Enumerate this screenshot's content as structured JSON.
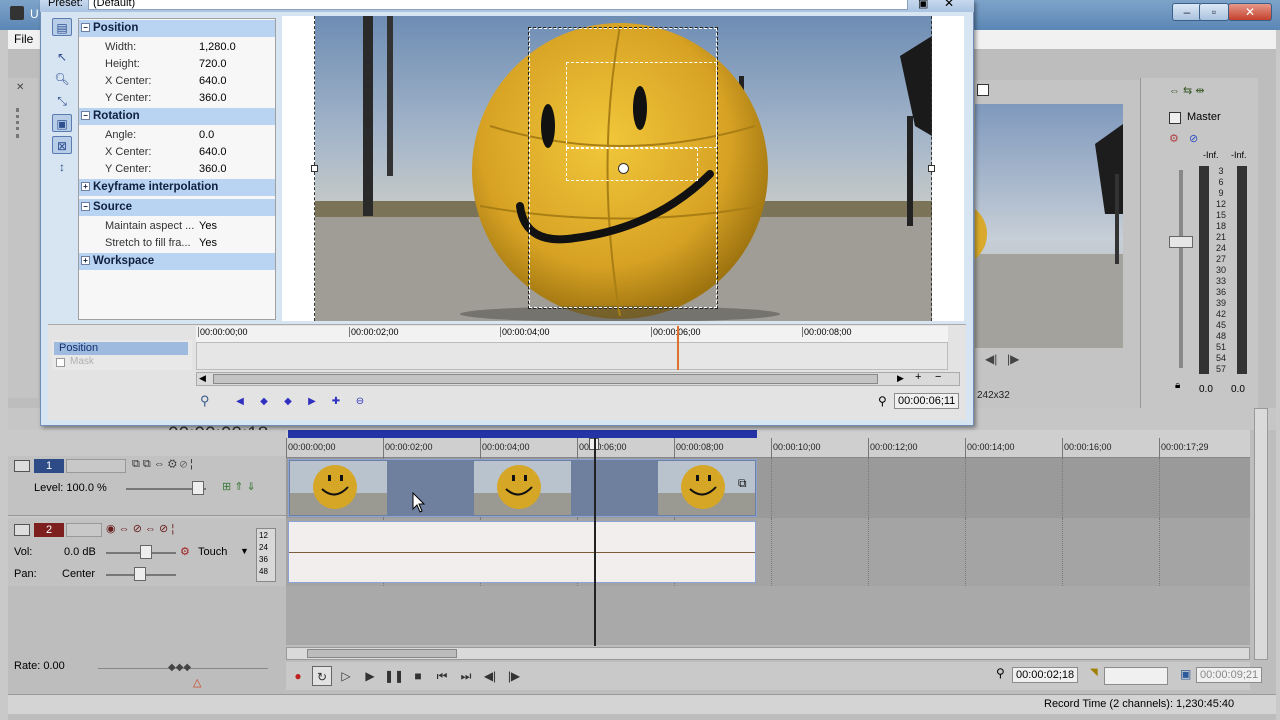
{
  "app": {
    "title": "U",
    "menu": [
      "File"
    ],
    "window_controls": [
      "–",
      "▫",
      "✕"
    ]
  },
  "dialog": {
    "preset_label": "Preset:",
    "preset_value": "(Default)",
    "properties": {
      "sections": [
        {
          "label": "Position",
          "expanded": true,
          "rows": [
            {
              "key": "Width:",
              "value": "1,280.0"
            },
            {
              "key": "Height:",
              "value": "720.0"
            },
            {
              "key": "X Center:",
              "value": "640.0"
            },
            {
              "key": "Y Center:",
              "value": "360.0"
            }
          ]
        },
        {
          "label": "Rotation",
          "expanded": true,
          "rows": [
            {
              "key": "Angle:",
              "value": "0.0"
            },
            {
              "key": "X Center:",
              "value": "640.0"
            },
            {
              "key": "Y Center:",
              "value": "360.0"
            }
          ]
        },
        {
          "label": "Keyframe interpolation",
          "expanded": false,
          "rows": []
        },
        {
          "label": "Source",
          "expanded": true,
          "rows": [
            {
              "key": "Maintain aspect ...",
              "value": "Yes"
            },
            {
              "key": "Stretch to fill fra...",
              "value": "Yes"
            }
          ]
        },
        {
          "label": "Workspace",
          "expanded": false,
          "rows": []
        }
      ]
    },
    "keyframes": {
      "tracks": [
        "Position",
        "Mask"
      ],
      "ruler": [
        "00:00:00;00",
        "00:00:02;00",
        "00:00:04;00",
        "00:00:06;00",
        "00:00:08;00"
      ],
      "cursor_time": "00:00:06;11"
    }
  },
  "timeline": {
    "current_time": "00:00:02;18",
    "ruler": [
      "00:00:00;00",
      "00:00:02;00",
      "00:00:04;00",
      "00:00:06;00",
      "00:00:08;00",
      "00:00:10;00",
      "00:00:12;00",
      "00:00:14;00",
      "00:00:16;00",
      "00:00:17;29"
    ],
    "video_track": {
      "number": "1",
      "level_label": "Level: 100.0 %"
    },
    "audio_track": {
      "number": "2",
      "vol_label": "Vol:",
      "vol_value": "0.0 dB",
      "pan_label": "Pan:",
      "pan_value": "Center",
      "touch_label": "Touch",
      "meter_scale": [
        "12",
        "24",
        "36",
        "48"
      ]
    },
    "rate_label": "Rate: 0.00",
    "cursor_time_box": "00:00:02;18",
    "end_time_box": "00:00:09;21",
    "status": "Record Time (2 channels): 1,230:45:40"
  },
  "preview": {
    "resolution_text": "242x32"
  },
  "mixer": {
    "title": "Master",
    "inf_left": "-Inf.",
    "inf_right": "-Inf.",
    "scale": [
      "3",
      "6",
      "9",
      "12",
      "15",
      "18",
      "21",
      "24",
      "27",
      "30",
      "33",
      "36",
      "39",
      "42",
      "45",
      "48",
      "51",
      "54",
      "57"
    ],
    "bottom_left": "0.0",
    "bottom_right": "0.0"
  }
}
